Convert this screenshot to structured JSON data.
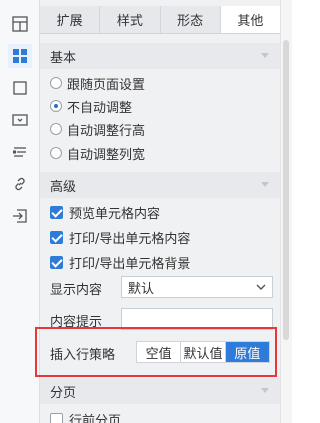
{
  "tabs": [
    {
      "label": "扩展",
      "active": false
    },
    {
      "label": "样式",
      "active": false
    },
    {
      "label": "形态",
      "active": false
    },
    {
      "label": "其他",
      "active": true
    }
  ],
  "sections": {
    "basic": {
      "title": "基本"
    },
    "advanced": {
      "title": "高级"
    },
    "paging": {
      "title": "分页"
    }
  },
  "basic_options": [
    {
      "label": "跟随页面设置",
      "selected": false
    },
    {
      "label": "不自动调整",
      "selected": true
    },
    {
      "label": "自动调整行高",
      "selected": false
    },
    {
      "label": "自动调整列宽",
      "selected": false
    }
  ],
  "advanced_checks": [
    {
      "label": "预览单元格内容",
      "checked": true
    },
    {
      "label": "打印/导出单元格内容",
      "checked": true
    },
    {
      "label": "打印/导出单元格背景",
      "checked": true
    }
  ],
  "display_content": {
    "label": "显示内容",
    "value": "默认"
  },
  "content_tip": {
    "label": "内容提示",
    "value": ""
  },
  "insert_row": {
    "label": "插入行策略",
    "options": [
      {
        "label": "空值",
        "active": false
      },
      {
        "label": "默认值",
        "active": false
      },
      {
        "label": "原值",
        "active": true
      }
    ]
  },
  "paging_checks": [
    {
      "label": "行前分页",
      "checked": false
    }
  ],
  "rail_icons": [
    {
      "name": "cell-layout-icon",
      "active": false
    },
    {
      "name": "cell-attribute-icon",
      "active": true
    },
    {
      "name": "border-icon",
      "active": false
    },
    {
      "name": "widget-icon",
      "active": false
    },
    {
      "name": "condition-icon",
      "active": false
    },
    {
      "name": "hyperlink-icon",
      "active": false
    },
    {
      "name": "import-icon",
      "active": false
    }
  ],
  "colors": {
    "accent": "#2f7bd9",
    "highlight_box": "#e8373a"
  }
}
